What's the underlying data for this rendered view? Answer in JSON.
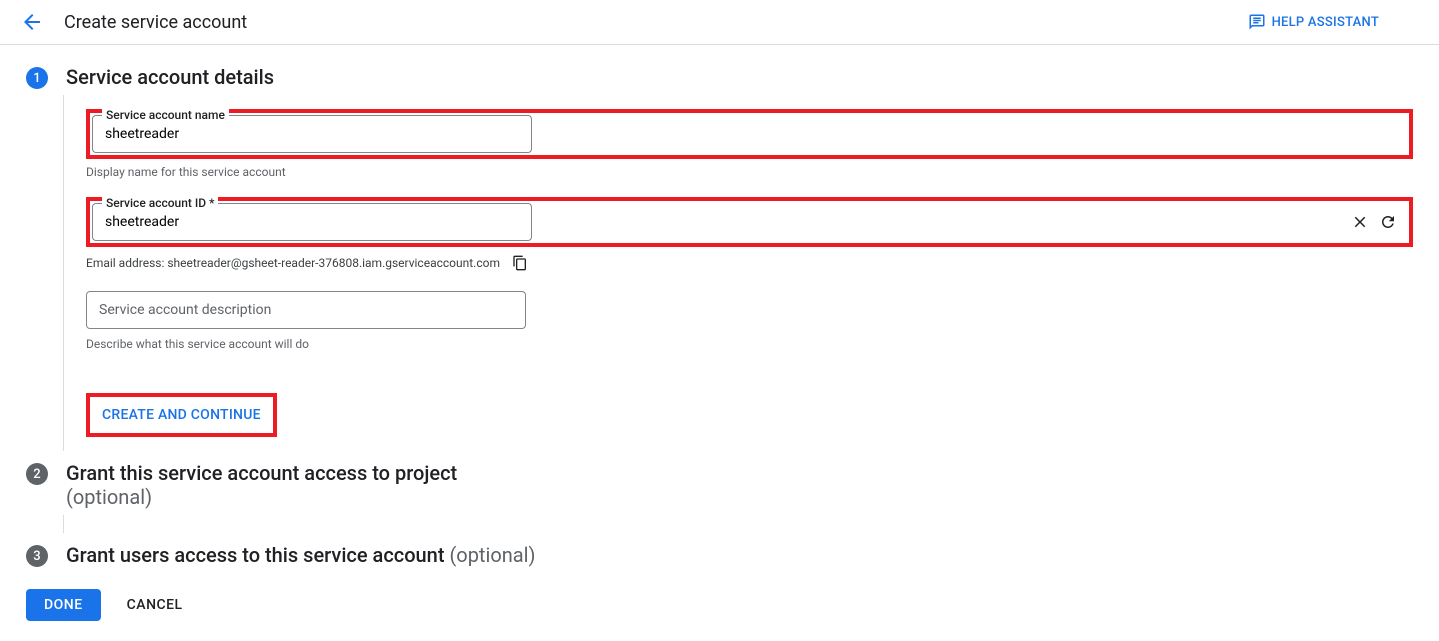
{
  "header": {
    "page_title": "Create service account",
    "help_label": "HELP ASSISTANT"
  },
  "step1": {
    "number": "1",
    "title": "Service account details",
    "name_field": {
      "label": "Service account name",
      "value": "sheetreader",
      "helper": "Display name for this service account"
    },
    "id_field": {
      "label": "Service account ID *",
      "value": "sheetreader"
    },
    "email_text": "Email address: sheetreader@gsheet-reader-376808.iam.gserviceaccount.com",
    "description_field": {
      "placeholder": "Service account description",
      "helper": "Describe what this service account will do"
    },
    "create_button": "CREATE AND CONTINUE"
  },
  "step2": {
    "number": "2",
    "title": "Grant this service account access to project",
    "optional": "(optional)"
  },
  "step3": {
    "number": "3",
    "title": "Grant users access to this service account ",
    "optional": "(optional)"
  },
  "footer": {
    "done": "DONE",
    "cancel": "CANCEL"
  }
}
